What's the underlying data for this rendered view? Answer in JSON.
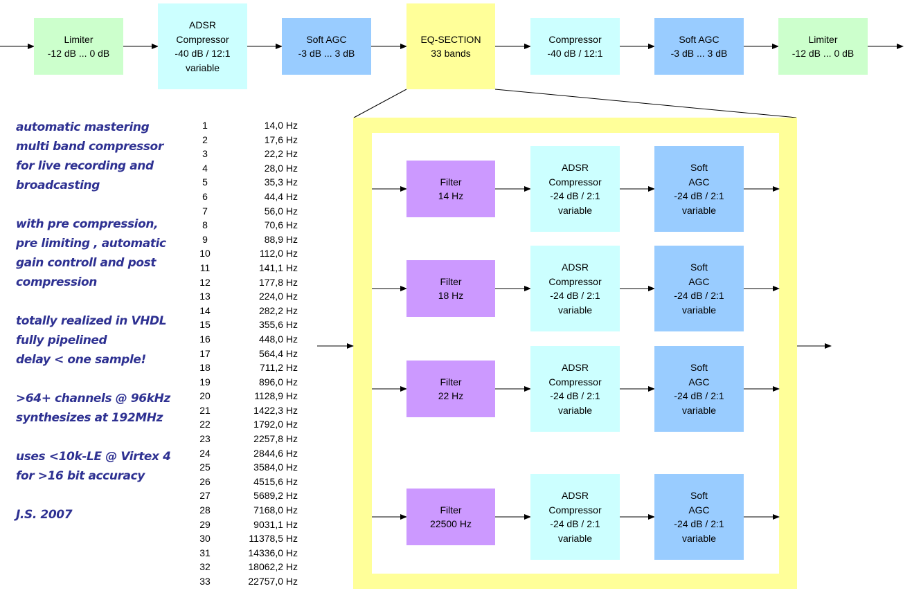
{
  "main_chain": [
    {
      "lines": [
        "Limiter",
        "-12 dB ... 0 dB"
      ],
      "color": "#ccffcc"
    },
    {
      "lines": [
        "ADSR",
        "Compressor",
        "-40 dB / 12:1",
        "variable"
      ],
      "color": "#ccffff"
    },
    {
      "lines": [
        "Soft AGC",
        "-3 dB ... 3 dB"
      ],
      "color": "#99ccff"
    },
    {
      "lines": [
        "EQ-SECTION",
        "33 bands"
      ],
      "color": "#ffff99"
    },
    {
      "lines": [
        "Compressor",
        "-40 dB / 12:1"
      ],
      "color": "#ccffff"
    },
    {
      "lines": [
        "Soft AGC",
        "-3 dB ... 3 dB"
      ],
      "color": "#99ccff"
    },
    {
      "lines": [
        "Limiter",
        "-12 dB ... 0 dB"
      ],
      "color": "#ccffcc"
    }
  ],
  "description": {
    "color": "#2e3192",
    "paragraphs": [
      [
        "automatic mastering",
        "multi band compressor",
        "for live recording and",
        "broadcasting"
      ],
      [
        "with pre compression,",
        "pre limiting , automatic",
        "gain controll and post",
        "compression"
      ],
      [
        "totally realized in VHDL",
        "fully pipelined",
        "delay < one sample!"
      ],
      [
        ">64+ channels @ 96kHz",
        "synthesizes at 192MHz"
      ],
      [
        "uses <10k-LE @ Virtex 4",
        "for >16 bit accuracy"
      ],
      [
        "J.S. 2007"
      ]
    ]
  },
  "bands": [
    {
      "n": "1",
      "f": "14,0 Hz"
    },
    {
      "n": "2",
      "f": "17,6 Hz"
    },
    {
      "n": "3",
      "f": "22,2 Hz"
    },
    {
      "n": "4",
      "f": "28,0 Hz"
    },
    {
      "n": "5",
      "f": "35,3 Hz"
    },
    {
      "n": "6",
      "f": "44,4 Hz"
    },
    {
      "n": "7",
      "f": "56,0 Hz"
    },
    {
      "n": "8",
      "f": "70,6 Hz"
    },
    {
      "n": "9",
      "f": "88,9 Hz"
    },
    {
      "n": "10",
      "f": "112,0 Hz"
    },
    {
      "n": "11",
      "f": "141,1 Hz"
    },
    {
      "n": "12",
      "f": "177,8 Hz"
    },
    {
      "n": "13",
      "f": "224,0 Hz"
    },
    {
      "n": "14",
      "f": "282,2 Hz"
    },
    {
      "n": "15",
      "f": "355,6 Hz"
    },
    {
      "n": "16",
      "f": "448,0 Hz"
    },
    {
      "n": "17",
      "f": "564,4 Hz"
    },
    {
      "n": "18",
      "f": "711,2 Hz"
    },
    {
      "n": "19",
      "f": "896,0 Hz"
    },
    {
      "n": "20",
      "f": "1128,9 Hz"
    },
    {
      "n": "21",
      "f": "1422,3 Hz"
    },
    {
      "n": "22",
      "f": "1792,0 Hz"
    },
    {
      "n": "23",
      "f": "2257,8 Hz"
    },
    {
      "n": "24",
      "f": "2844,6 Hz"
    },
    {
      "n": "25",
      "f": "3584,0 Hz"
    },
    {
      "n": "26",
      "f": "4515,6 Hz"
    },
    {
      "n": "27",
      "f": "5689,2 Hz"
    },
    {
      "n": "28",
      "f": "7168,0 Hz"
    },
    {
      "n": "29",
      "f": "9031,1 Hz"
    },
    {
      "n": "30",
      "f": "11378,5 Hz"
    },
    {
      "n": "31",
      "f": "14336,0 Hz"
    },
    {
      "n": "32",
      "f": "18062,2 Hz"
    },
    {
      "n": "33",
      "f": "22757,0 Hz"
    }
  ],
  "eq_section": {
    "frame_color": "#ffff99",
    "rows": [
      {
        "filter": [
          "Filter",
          "14 Hz"
        ],
        "compressor": [
          "ADSR",
          "Compressor",
          "-24 dB / 2:1",
          "variable"
        ],
        "agc": [
          "Soft",
          "AGC",
          "-24 dB / 2:1",
          "variable"
        ]
      },
      {
        "filter": [
          "Filter",
          "18 Hz"
        ],
        "compressor": [
          "ADSR",
          "Compressor",
          "-24 dB / 2:1",
          "variable"
        ],
        "agc": [
          "Soft",
          "AGC",
          "-24 dB / 2:1",
          "variable"
        ]
      },
      {
        "filter": [
          "Filter",
          "22 Hz"
        ],
        "compressor": [
          "ADSR",
          "Compressor",
          "-24 dB / 2:1",
          "variable"
        ],
        "agc": [
          "Soft",
          "AGC",
          "-24 dB / 2:1",
          "variable"
        ]
      },
      {
        "filter": [
          "Filter",
          "22500 Hz"
        ],
        "compressor": [
          "ADSR",
          "Compressor",
          "-24 dB / 2:1",
          "variable"
        ],
        "agc": [
          "Soft",
          "AGC",
          "-24 dB / 2:1",
          "variable"
        ]
      }
    ],
    "colors": {
      "filter": "#cc99ff",
      "compressor": "#ccffff",
      "agc": "#99ccff"
    }
  }
}
